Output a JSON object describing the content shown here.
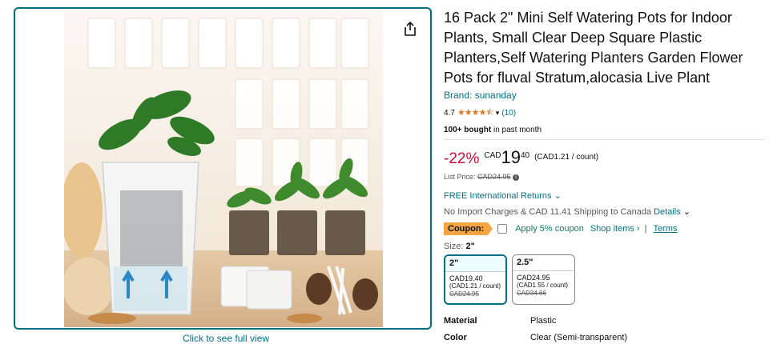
{
  "image_panel": {
    "share_icon": "share-icon",
    "full_view_link": "Click to see full view",
    "photo": "product-photo"
  },
  "product": {
    "title": "16 Pack 2\" Mini Self Watering Pots for Indoor Plants, Small Clear Deep Square Plastic Planters,Self Watering Planters Garden Flower Pots for fluval Stratum,alocasia Live Plant",
    "brand": "Brand: sunanday",
    "rating_value": "4.7",
    "rating_stars": "★★★★⯪",
    "review_count": "(10)",
    "bought_bold": "100+ bought",
    "bought_rest": " in past month"
  },
  "price": {
    "discount": "-22%",
    "currency": "CAD",
    "whole": "19",
    "fraction": "40",
    "per_count": "(CAD1.21 / count)",
    "list_label": "List Price: ",
    "list_value": "CAD24.95"
  },
  "shipping": {
    "returns": "FREE International Returns",
    "import_text": "No Import Charges & CAD 11.41 Shipping to Canada ",
    "details_link": "Details"
  },
  "coupon": {
    "badge": "Coupon:",
    "apply": "Apply 5% coupon",
    "shop": "Shop items ›",
    "separator": "|",
    "terms": "Terms"
  },
  "size": {
    "label": "Size: ",
    "selected": "2\"",
    "options": [
      {
        "name": "2\"",
        "price": "CAD19.40",
        "per": "(CAD1.21 / count)",
        "list": "CAD24.95"
      },
      {
        "name": "2.5\"",
        "price": "CAD24.95",
        "per": "(CAD1.55 / count)",
        "list": "CAD34.66"
      }
    ]
  },
  "specs": [
    {
      "key": "Material",
      "value": "Plastic"
    },
    {
      "key": "Color",
      "value": "Clear (Semi-transparent)"
    }
  ],
  "colors": {
    "link": "#007185",
    "deal_red": "#cc0c39",
    "coupon_orange": "#f7a541",
    "coupon_green": "#067d62"
  }
}
